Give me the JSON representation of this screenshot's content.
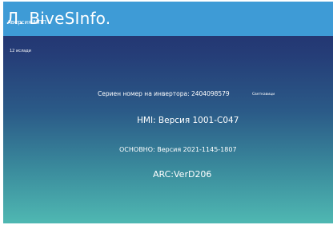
{
  "header": {
    "title": "Л. BiveSInfo.",
    "overlay_text": "Аверсия МПП",
    "background_color": "#3e9bd6"
  },
  "time_label": "12 ислади",
  "info": {
    "serial": "Сериен номер на инвертора: 2404098579",
    "flash_button": "Светкавици",
    "hmi_version": "HMI: Версия 1001-C047",
    "main_version": "ОСНОВНО: Версия 2021-1145-1807",
    "arc_version": "ARC:VerD206"
  },
  "colors": {
    "gradient_top": "#232c6a",
    "gradient_bottom": "#4fb8b2",
    "text": "#ffffff"
  }
}
